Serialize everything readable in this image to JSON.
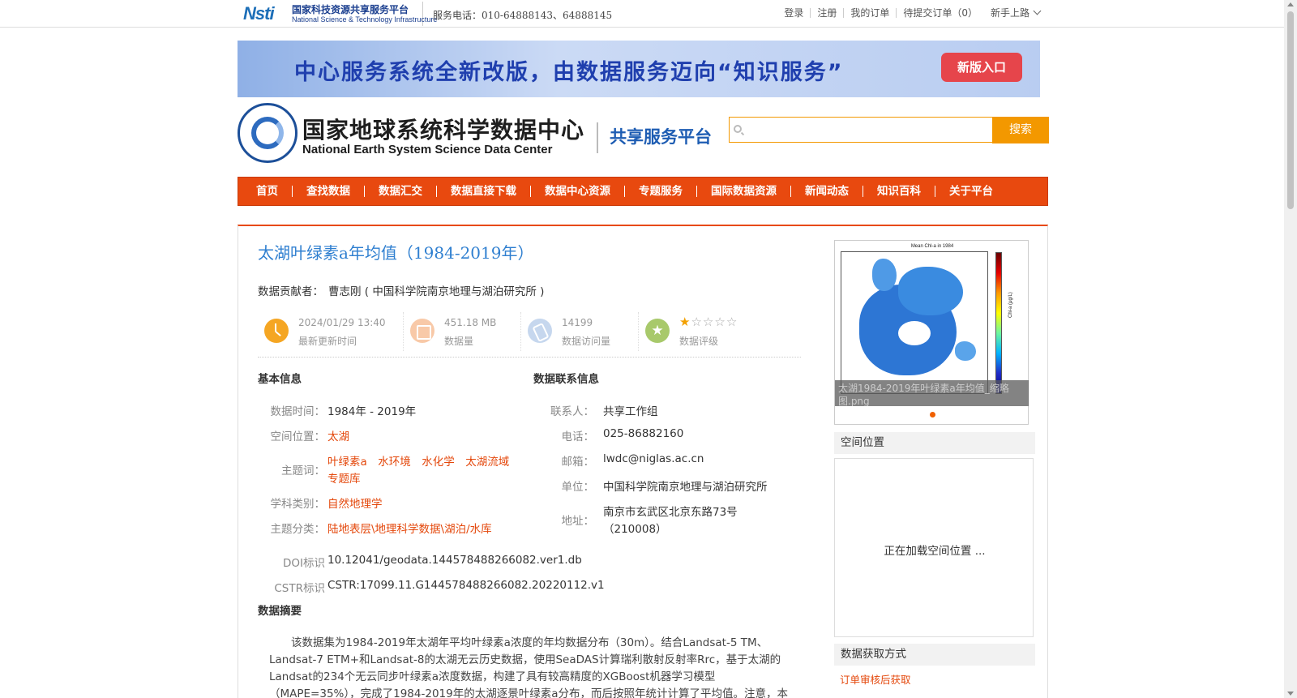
{
  "topbar": {
    "logo_mark": "Nsti",
    "logo_cn": "国家科技资源共享服务平台",
    "logo_en": "National Science & Technology Infrastructure",
    "hotline": "服务电话：010-64888143、64888145",
    "links": [
      "登录",
      "注册",
      "我的订单",
      "待提交订单（0）"
    ],
    "newbie": "新手上路"
  },
  "banner": {
    "text": "中心服务系统全新改版，由数据服务迈向“知识服务”",
    "button": "新版入口"
  },
  "header": {
    "title_cn": "国家地球系统科学数据中心",
    "title_en": "National Earth System Science Data Center",
    "platform": "共享服务平台",
    "search_placeholder": "",
    "search_button": "搜索"
  },
  "nav": [
    "首页",
    "查找数据",
    "数据汇交",
    "数据直接下载",
    "数据中心资源",
    "专题服务",
    "国际数据资源",
    "新闻动态",
    "知识百科",
    "关于平台"
  ],
  "dataset": {
    "title": "太湖叶绿素a年均值（1984-2019年）",
    "contributor_label": "数据贡献者：",
    "contributor": "曹志刚 ( 中国科学院南京地理与湖泊研究所 )",
    "stats": {
      "updated": "2024/01/29 13:40",
      "updated_label": "最新更新时间",
      "size": "451.18 MB",
      "size_label": "数据量",
      "visits": "14199",
      "visits_label": "数据访问量",
      "rating": 1,
      "rating_max": 5,
      "rating_label": "数据评级"
    }
  },
  "basic": {
    "heading": "基本信息",
    "time_label": "数据时间：",
    "time": "1984年 - 2019年",
    "location_label": "空间位置：",
    "location": "太湖",
    "keywords_label": "主题词：",
    "keywords_line1": "叶绿素a　水环境　水化学　太湖流域",
    "keywords_line2": "专题库",
    "discipline_label": "学科类别：",
    "discipline": "自然地理学",
    "category_label": "主题分类：",
    "category": "陆地表层\\地理科学数据\\湖泊/水库",
    "doi_label": "DOI标识",
    "doi": "10.12041/geodata.144578488266082.ver1.db",
    "cstr_label": "CSTR标识",
    "cstr": "CSTR:17099.11.G144578488266082.20220112.v1"
  },
  "contact": {
    "heading": "数据联系信息",
    "person_label": "联系人：",
    "person": "共享工作组",
    "phone_label": "电话：",
    "phone": "025-86882160",
    "email_label": "邮箱：",
    "email": "lwdc@niglas.ac.cn",
    "unit_label": "单位：",
    "unit": "中国科学院南京地理与湖泊研究所",
    "address_label": "地址：",
    "address_line1": "南京市玄武区北京东路73号",
    "address_line2": "（210008）"
  },
  "abstract": {
    "heading": "数据摘要",
    "text": "该数据集为1984-2019年太湖年平均叶绿素a浓度的年均数据分布（30m）。结合Landsat-5 TM、Landsat-7 ETM+和Landsat-8的太湖无云历史数据，使用SeaDAS计算瑞利散射反射率Rrc，基于太湖的Landsat的234个无云同步叶绿素a浓度数据，构建了具有较高精度的XGBoost机器学习模型（MAPE=35%），完成了1984-2019年的太湖逐景叶绿素a分布，而后按照年统计计算了平均值。注意，本"
  },
  "sidebar": {
    "preview_title": "Mean Chl-a in 1984",
    "colorbar_label": "Chl-a (μg/L)",
    "preview_caption": "太湖1984-2019年叶绿素a年均值_缩略图.png",
    "spatial_heading": "空间位置",
    "spatial_loading": "正在加载空间位置 ...",
    "acquire_heading": "数据获取方式",
    "acquire_method": "订单审核后获取"
  },
  "colors": {
    "nav_bg": "#e8490f",
    "accent_orange": "#f39800",
    "title_blue": "#2f7fd0",
    "link_orange": "#e4480c"
  }
}
